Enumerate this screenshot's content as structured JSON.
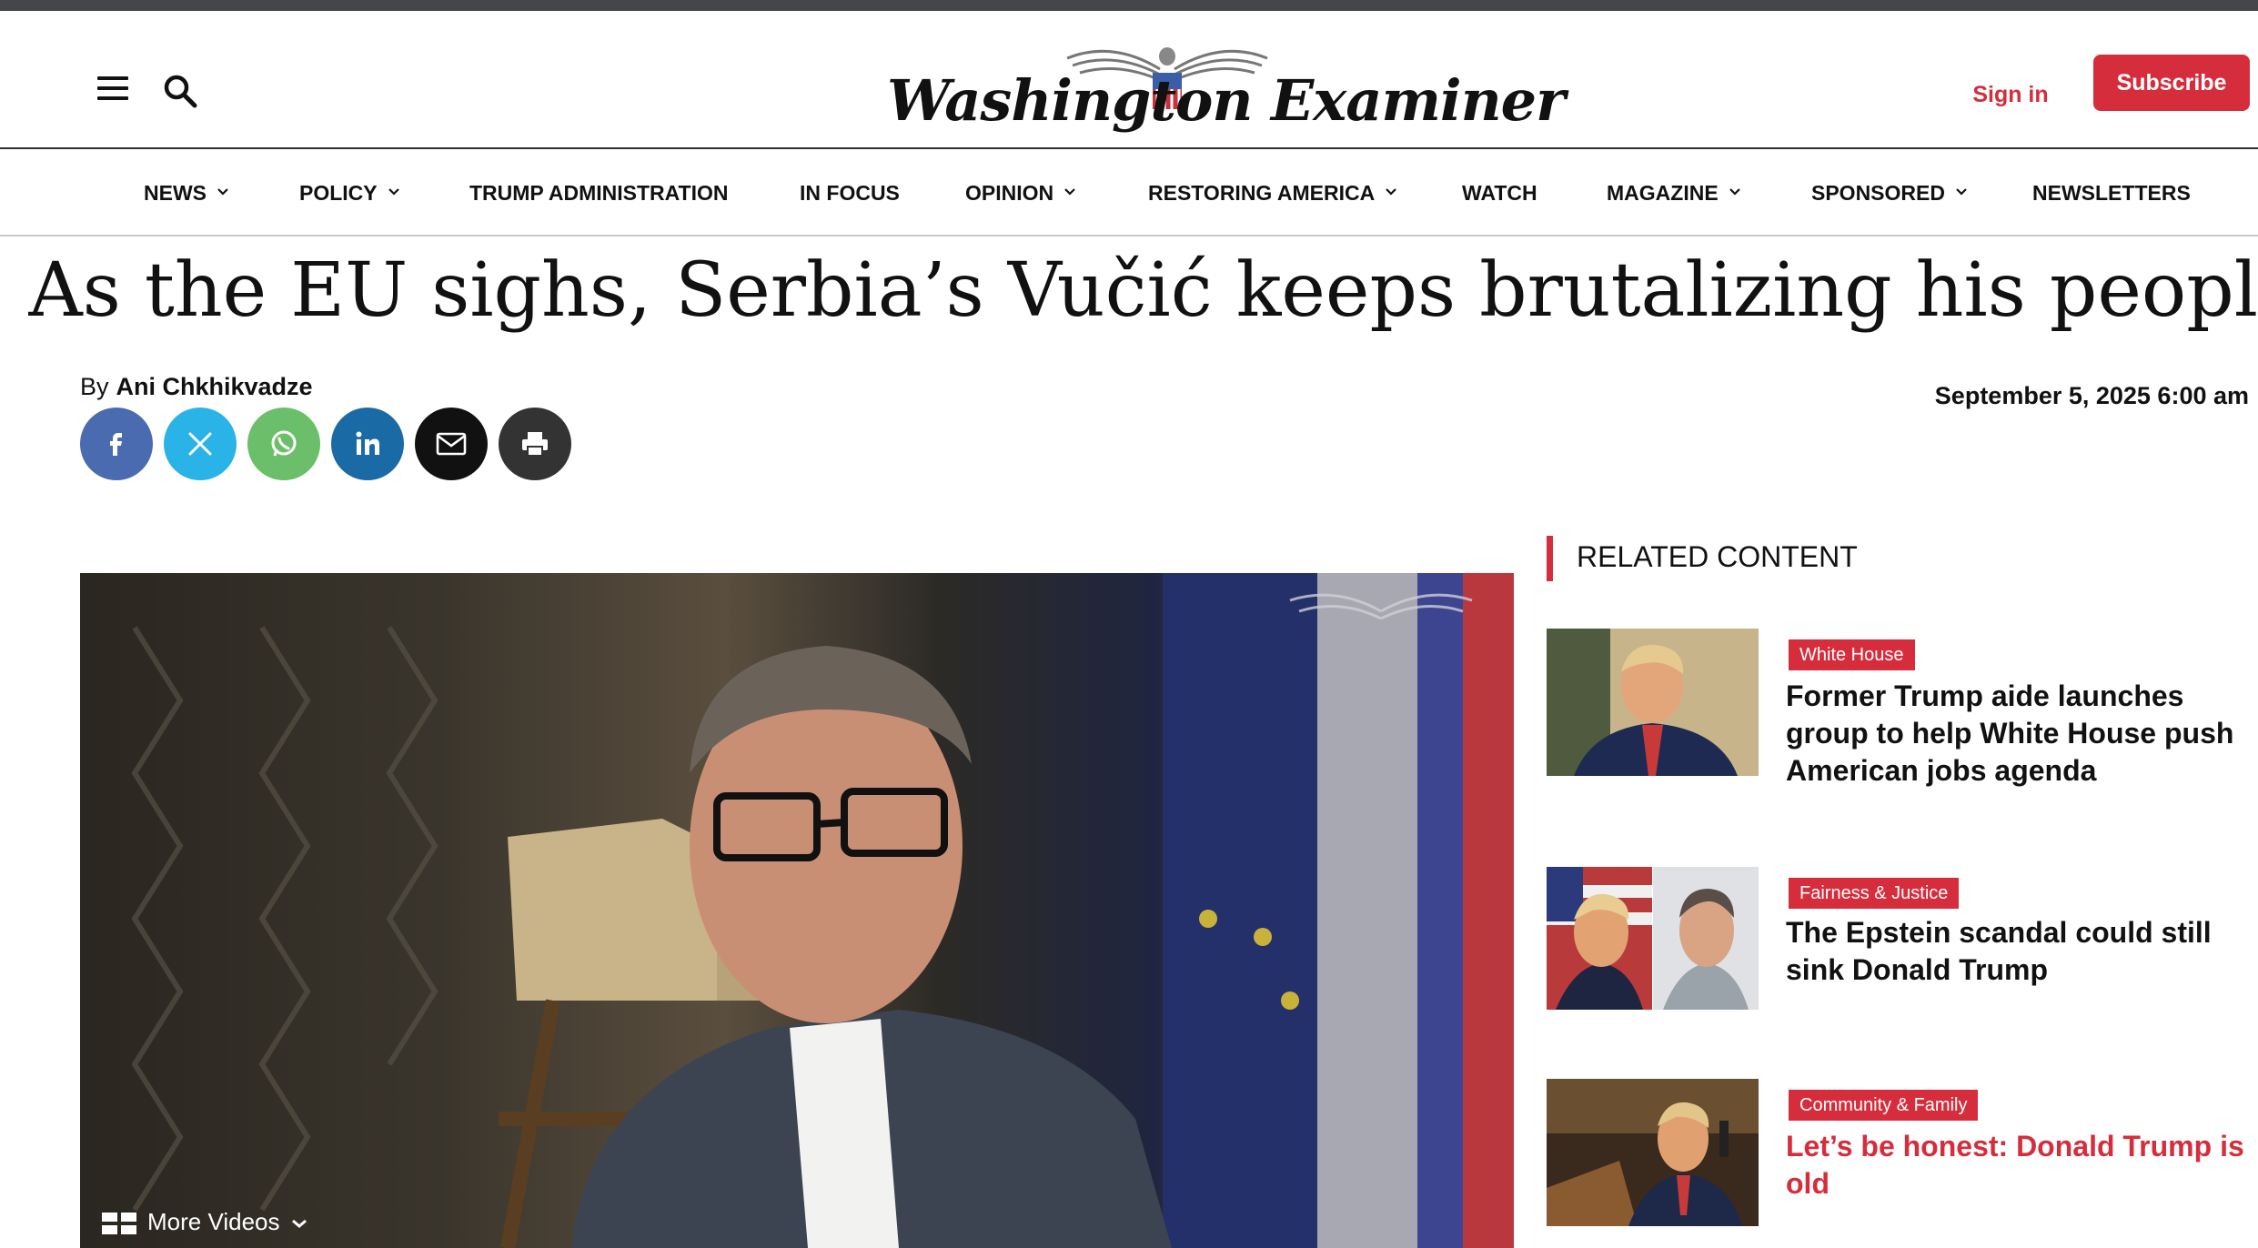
{
  "colors": {
    "accent": "#d62d3c",
    "top_strip": "#45454c",
    "facebook": "#4a6bb0",
    "x": "#2ab3e6",
    "whatsapp": "#6cbf6a",
    "linkedin": "#1a6aa6",
    "email": "#111111",
    "print": "#333333"
  },
  "header": {
    "menu_icon": "hamburger-menu-icon",
    "search_icon": "search-icon",
    "logo_text": "Washington Examiner",
    "signin_label": "Sign in",
    "subscribe_label": "Subscribe"
  },
  "nav": {
    "items": [
      {
        "label": "NEWS",
        "dropdown": true
      },
      {
        "label": "POLICY",
        "dropdown": true
      },
      {
        "label": "TRUMP ADMINISTRATION",
        "dropdown": false
      },
      {
        "label": "IN FOCUS",
        "dropdown": false
      },
      {
        "label": "OPINION",
        "dropdown": true
      },
      {
        "label": "RESTORING AMERICA",
        "dropdown": true
      },
      {
        "label": "WATCH",
        "dropdown": false
      },
      {
        "label": "MAGAZINE",
        "dropdown": true
      },
      {
        "label": "SPONSORED",
        "dropdown": true
      },
      {
        "label": "NEWSLETTERS",
        "dropdown": false
      }
    ]
  },
  "article": {
    "headline": "As the EU sighs, Serbia’s Vučić keeps brutalizing his people",
    "by": "By",
    "author": "Ani Chkhikvadze",
    "date": "September 5, 2025 6:00 am",
    "share": [
      {
        "name": "facebook",
        "icon": "facebook-icon"
      },
      {
        "name": "x",
        "icon": "x-icon"
      },
      {
        "name": "whatsapp",
        "icon": "whatsapp-icon"
      },
      {
        "name": "linkedin",
        "icon": "linkedin-icon"
      },
      {
        "name": "email",
        "icon": "email-icon"
      },
      {
        "name": "print",
        "icon": "print-icon"
      }
    ],
    "video": {
      "more_videos_label": "More Videos"
    }
  },
  "related": {
    "title": "RELATED CONTENT",
    "items": [
      {
        "tag": "White House",
        "title": "Former Trump aide launches group to help White House push American jobs agenda"
      },
      {
        "tag": "Fairness & Justice",
        "title": "The Epstein scandal could still sink Donald Trump"
      },
      {
        "tag": "Community & Family",
        "title": "Let’s be honest: Donald Trump is old"
      }
    ]
  }
}
